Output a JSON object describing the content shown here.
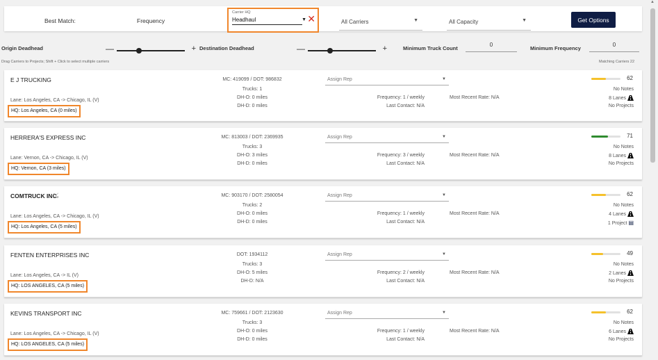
{
  "topbar": {
    "best_match_label": "Best Match:",
    "frequency_label": "Frequency",
    "carrier_hq": {
      "small_label": "Carrier HQ",
      "value": "Headhaul"
    },
    "carriers_select": "All Carriers",
    "capacity_select": "All Capacity",
    "get_options_label": "Get Options"
  },
  "filters": {
    "origin_deadhead_label": "Origin Deadhead",
    "destination_deadhead_label": "Destination Deadhead",
    "min_truck_count_label": "Minimum Truck Count",
    "min_truck_count_value": "0",
    "min_frequency_label": "Minimum Frequency",
    "min_frequency_value": "0",
    "drag_hint": "Drag Carriers to Projects; Shift + Click to select multiple carriers",
    "matching_label": "Matching Carriers 22",
    "minus": "—",
    "plus": "+"
  },
  "assign_rep_placeholder": "Assign Rep",
  "colors": {
    "accent": "#f0862b",
    "button": "#0f1d44",
    "score_yellow": "#f5c12b",
    "score_green": "#2e8b2e"
  },
  "carriers": [
    {
      "name": "E J TRUCKING",
      "mc_dot": "MC: 419099 / DOT: 986832",
      "trucks": "Trucks: 1",
      "dh_o": "DH-O: 0 miles",
      "dh_d": "DH-D: 0 miles",
      "lane": "Lane: Los Angeles, CA -> Chicago, IL (V)",
      "hq": "HQ: Los Angeles, CA (0 miles)",
      "frequency": "Frequency: 1 / weekly",
      "last_contact": "Last Contact: N/A",
      "recent_rate": "Most Recent Rate: N/A",
      "score": "62",
      "score_pct": 0.62,
      "notes": "No Notes",
      "lanes": "8 Lanes",
      "projects": "No Projects"
    },
    {
      "name": "HERRERA'S EXPRESS INC",
      "mc_dot": "MC: 813003 / DOT: 2369935",
      "trucks": "Trucks: 3",
      "dh_o": "DH-O: 3 miles",
      "dh_d": "DH-D: 0 miles",
      "lane": "Lane: Vernon, CA -> Chicago, IL (V)",
      "hq": "HQ: Vernon, CA (3 miles)",
      "frequency": "Frequency: 3 / weekly",
      "last_contact": "Last Contact: N/A",
      "recent_rate": "Most Recent Rate: N/A",
      "score": "71",
      "score_pct": 0.71,
      "notes": "No Notes",
      "lanes": "8 Lanes",
      "projects": "No Projects"
    },
    {
      "name": "COMTRUCK INC",
      "mc_dot": "MC: 903170 / DOT: 2580054",
      "trucks": "Trucks: 2",
      "dh_o": "DH-O: 0 miles",
      "dh_d": "DH-D: 0 miles",
      "lane": "Lane: Los Angeles, CA -> Chicago, IL (V)",
      "hq": "HQ: Los Angeles, CA (5 miles)",
      "frequency": "Frequency: 1 / weekly",
      "last_contact": "Last Contact: N/A",
      "recent_rate": "Most Recent Rate: N/A",
      "score": "62",
      "score_pct": 0.62,
      "notes": "No Notes",
      "lanes": "4 Lanes",
      "projects": "1 Project"
    },
    {
      "name": "FENTEN ENTERPRISES INC",
      "mc_dot": "DOT: 1934112",
      "trucks": "Trucks: 3",
      "dh_o": "DH-O: 5 miles",
      "dh_d": "DH-D: N/A",
      "lane": "Lane: Los Angeles, CA -> IL (V)",
      "hq": "HQ: LOS ANGELES, CA (5 miles)",
      "frequency": "Frequency: 2 / weekly",
      "last_contact": "Last Contact: N/A",
      "recent_rate": "Most Recent Rate: N/A",
      "score": "49",
      "score_pct": 0.49,
      "notes": "No Notes",
      "lanes": "2 Lanes",
      "projects": "No Projects"
    },
    {
      "name": "KEVINS TRANSPORT INC",
      "mc_dot": "MC: 759661 / DOT: 2123630",
      "trucks": "Trucks: 3",
      "dh_o": "DH-O: 0 miles",
      "dh_d": "DH-D: 0 miles",
      "lane": "Lane: Los Angeles, CA -> Chicago, IL (V)",
      "hq": "HQ: LOS ANGELES, CA (5 miles)",
      "frequency": "Frequency: 1 / weekly",
      "last_contact": "Last Contact: N/A",
      "recent_rate": "Most Recent Rate: N/A",
      "score": "62",
      "score_pct": 0.62,
      "notes": "No Notes",
      "lanes": "6 Lanes",
      "projects": "No Projects"
    }
  ]
}
